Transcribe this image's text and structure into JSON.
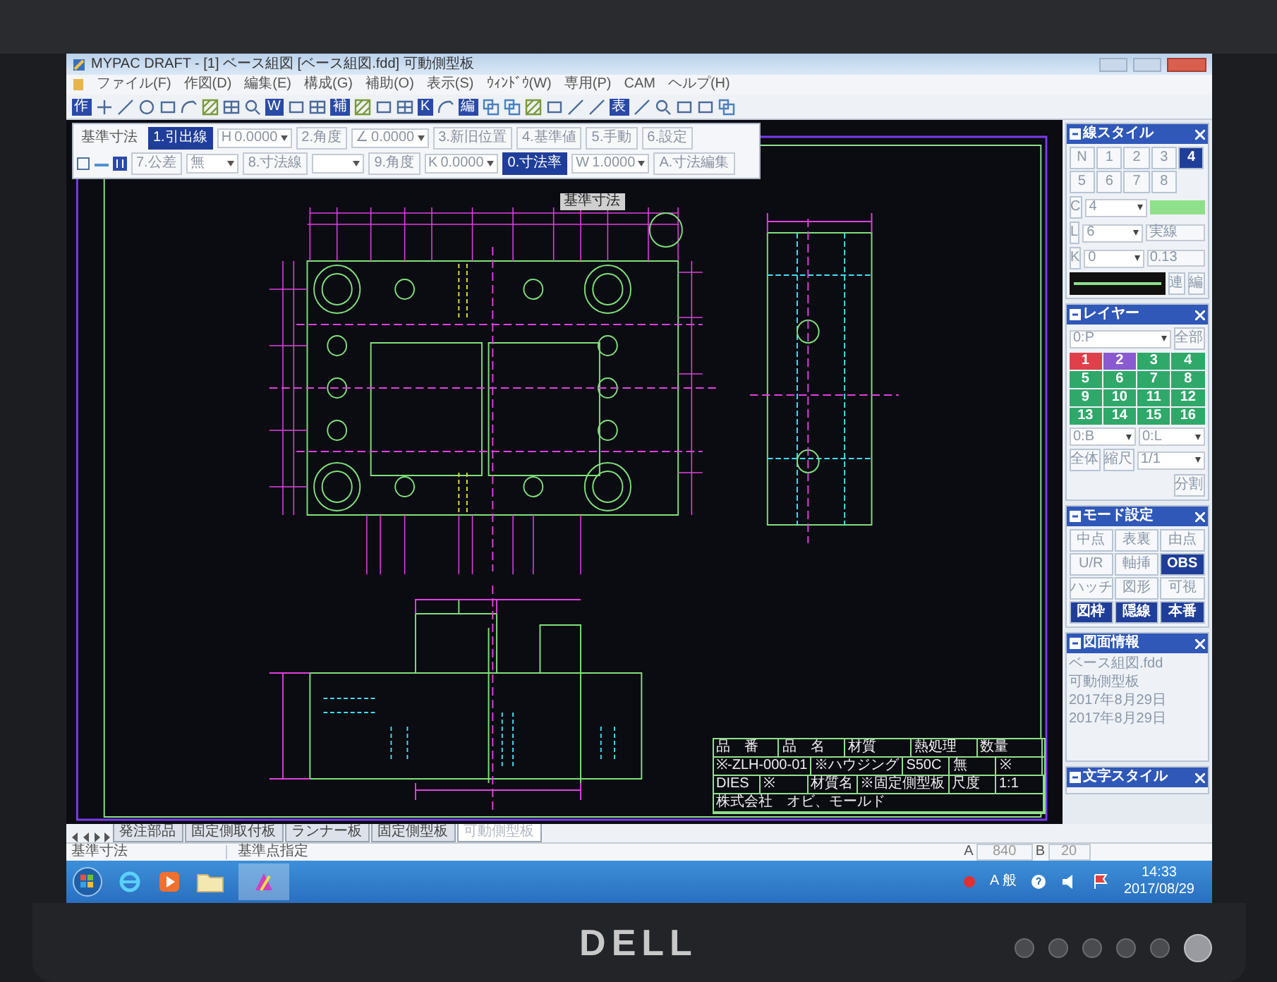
{
  "window": {
    "title": "MYPAC DRAFT - [1] ベース組図 [ベース組図.fdd] 可動側型板"
  },
  "menu": [
    "ファイル(F)",
    "作図(D)",
    "編集(E)",
    "構成(G)",
    "補助(O)",
    "表示(S)",
    "ｳｨﾝﾄﾞｳ(W)",
    "専用(P)",
    "CAM",
    "ヘルプ(H)"
  ],
  "toolbar": [
    "作",
    "W",
    "補",
    "K",
    "編",
    "表"
  ],
  "dimension_bar": {
    "title": "基準寸法",
    "row_1": [
      {
        "kind": "button",
        "label": "1.引出線",
        "selected": true
      },
      {
        "kind": "field",
        "prefix": "H",
        "value": "0.0000"
      },
      {
        "kind": "button",
        "label": "2.角度",
        "selected": false
      },
      {
        "kind": "field",
        "prefix": "∠",
        "value": "0.0000"
      },
      {
        "kind": "button",
        "label": "3.新旧位置",
        "selected": false
      },
      {
        "kind": "button",
        "label": "4.基準値",
        "selected": false
      },
      {
        "kind": "button",
        "label": "5.手動",
        "selected": false
      },
      {
        "kind": "button",
        "label": "6.設定",
        "selected": false
      }
    ],
    "row_2": [
      {
        "kind": "button",
        "label": "7.公差",
        "selected": false
      },
      {
        "kind": "field",
        "value": "無"
      },
      {
        "kind": "button",
        "label": "8.寸法線",
        "selected": false
      },
      {
        "kind": "field"
      },
      {
        "kind": "button",
        "label": "9.角度",
        "selected": false
      },
      {
        "kind": "field",
        "prefix": "K",
        "value": "0.0000"
      },
      {
        "kind": "button",
        "label": "0.寸法率",
        "selected": true
      },
      {
        "kind": "field",
        "prefix": "W",
        "value": "1.0000"
      },
      {
        "kind": "button",
        "label": "A.寸法編集",
        "selected": false
      }
    ]
  },
  "drawing": {
    "label": "基準寸法",
    "title_block": [
      [
        "品　番",
        "品　名",
        "材質",
        "熱処理",
        "数量"
      ],
      [
        "※-ZLH-000-01",
        "※ハウジング",
        "S50C",
        "無",
        "※"
      ],
      [
        "DIES",
        "※",
        "材質名",
        "※固定側型板",
        "尺度",
        "1:1"
      ],
      [
        "株式会社　オビ、モールド"
      ]
    ]
  },
  "line_style_panel": {
    "title": "線スタイル",
    "buttons": [
      {
        "label": "N",
        "selected": false
      },
      {
        "label": "1",
        "selected": false
      },
      {
        "label": "2",
        "selected": false
      },
      {
        "label": "3",
        "selected": false
      },
      {
        "label": "4",
        "selected": true
      },
      {
        "label": "5",
        "selected": false
      },
      {
        "label": "6",
        "selected": false
      },
      {
        "label": "7",
        "selected": false
      },
      {
        "label": "8",
        "selected": false
      }
    ],
    "rows": [
      {
        "key": "C",
        "value": "4"
      },
      {
        "key": "L",
        "value": "6",
        "extra": "実線"
      },
      {
        "key": "K",
        "value": "0",
        "extra": "0.13"
      }
    ],
    "actions": [
      "連",
      "編"
    ]
  },
  "layer_panel": {
    "title": "レイヤー",
    "layer": "0:P",
    "all": "全部",
    "layers": [
      {
        "label": "1",
        "color": "#e0404a"
      },
      {
        "label": "2",
        "color": "#8a5ad0"
      },
      {
        "label": "3",
        "color": "#2fa86a"
      },
      {
        "label": "4",
        "color": "#2fa86a"
      },
      {
        "label": "5",
        "color": "#2fa86a"
      },
      {
        "label": "6",
        "color": "#2fa86a"
      },
      {
        "label": "7",
        "color": "#2fa86a"
      },
      {
        "label": "8",
        "color": "#2fa86a"
      },
      {
        "label": "9",
        "color": "#2fa86a"
      },
      {
        "label": "10",
        "color": "#2fa86a"
      },
      {
        "label": "11",
        "color": "#2fa86a"
      },
      {
        "label": "12",
        "color": "#2fa86a"
      },
      {
        "label": "13",
        "color": "#2fa86a"
      },
      {
        "label": "14",
        "color": "#2fa86a"
      },
      {
        "label": "15",
        "color": "#2fa86a"
      },
      {
        "label": "16",
        "color": "#2fa86a"
      }
    ],
    "fields": [
      "0:B",
      "0:L"
    ],
    "whole": "全体",
    "scale_label": "縮尺",
    "scale": "1/1",
    "split": "分割"
  },
  "mode_panel": {
    "title": "モード設定",
    "buttons": [
      {
        "label": "中点",
        "on": false
      },
      {
        "label": "表裏",
        "on": false
      },
      {
        "label": "由点",
        "on": false
      },
      {
        "label": "U/R",
        "on": false
      },
      {
        "label": "軸挿",
        "on": false
      },
      {
        "label": "OBS",
        "on": true
      },
      {
        "label": "ハッチ",
        "on": false
      },
      {
        "label": "図形",
        "on": false
      },
      {
        "label": "可視",
        "on": false
      },
      {
        "label": "図枠",
        "on": true
      },
      {
        "label": "隠線",
        "on": true
      },
      {
        "label": "本番",
        "on": true
      }
    ]
  },
  "drawing_info_panel": {
    "title": "図面情報",
    "lines": [
      "ベース組図.fdd",
      "可動側型板",
      "2017年8月29日",
      "2017年8月29日"
    ]
  },
  "text_style_panel": {
    "title": "文字スタイル"
  },
  "sheet_tabs": [
    {
      "label": "発注部品",
      "selected": false
    },
    {
      "label": "固定側取付板",
      "selected": false
    },
    {
      "label": "ランナー板",
      "selected": false
    },
    {
      "label": "固定側型板",
      "selected": false
    },
    {
      "label": "可動側型板",
      "selected": true
    }
  ],
  "status_bar": {
    "mode": "基準寸法",
    "prompt": "基準点指定",
    "a_label": "A",
    "a_value": "840",
    "b_label": "B",
    "b_value": "20"
  },
  "taskbar": {
    "ime": "A 般",
    "time": "14:33",
    "date": "2017/08/29"
  },
  "monitor": {
    "brand": "DELL"
  }
}
